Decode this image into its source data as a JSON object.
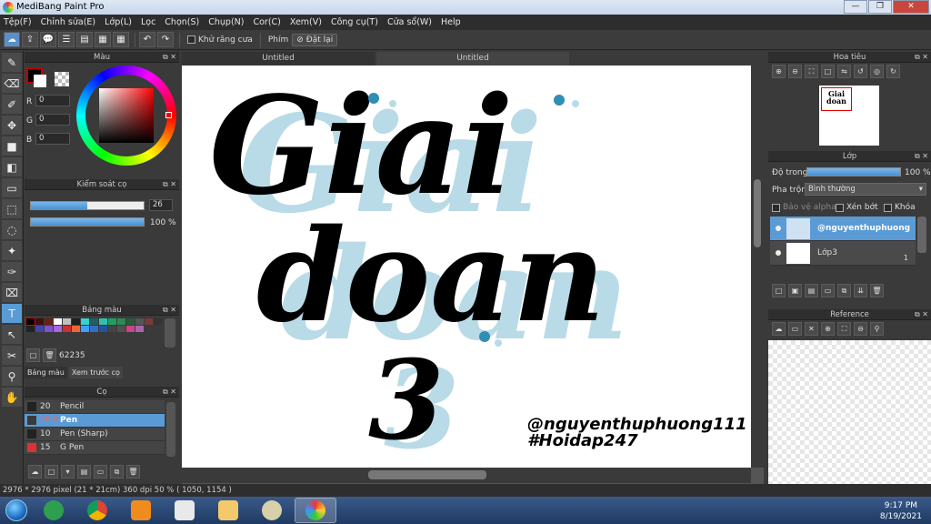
{
  "window": {
    "title": "MediBang Paint Pro",
    "minimize": "—",
    "restore": "❐",
    "close": "✕"
  },
  "menu": [
    "Tệp(F)",
    "Chỉnh sửa(E)",
    "Lớp(L)",
    "Lọc",
    "Chọn(S)",
    "Chụp(N)",
    "Cor(C)",
    "Xem(V)",
    "Công cụ(T)",
    "Cửa sổ(W)",
    "Help"
  ],
  "toolbar": {
    "antialias_label": "Khử răng cưa",
    "shortcut_label": "Phím",
    "reset_label": "Đặt lại"
  },
  "tabs": [
    {
      "label": "Untitled"
    },
    {
      "label": "Untitled"
    }
  ],
  "color_panel": {
    "title": "Màu",
    "r_label": "R",
    "g_label": "G",
    "b_label": "B",
    "r_value": "0",
    "g_value": "0",
    "b_value": "0",
    "fg_color": "#000000",
    "accent": "#c00000"
  },
  "brush_control": {
    "title": "Kiểm soát cọ",
    "size_value": "26",
    "size_fraction": 0.5,
    "opacity_value": "100 %",
    "opacity_fraction": 1.0
  },
  "palette": {
    "title": "Bảng màu",
    "count": "62235",
    "tab_palette": "Bảng màu",
    "tab_preview": "Xem trước cọ",
    "colors": [
      "#000000",
      "#3a1010",
      "#6a2010",
      "#ffffff",
      "#c0c0c0",
      "#202020",
      "#3ad0d0",
      "#206060",
      "#30c0b0",
      "#20a060",
      "#2d8a55",
      "#285c3a",
      "#555555",
      "#7a3a3a",
      "#333333",
      "#222222",
      "#4444aa",
      "#7a55cc",
      "#aa66dd",
      "#cc3030",
      "#ee6633",
      "#40a0ff",
      "#3070cc",
      "#225599",
      "#444444",
      "#505050",
      "#cc4488",
      "#aa66aa"
    ]
  },
  "brushes": {
    "title": "Cọ",
    "items": [
      {
        "size": "20",
        "name": "Pencil",
        "color": "#222222"
      },
      {
        "size": "26.0",
        "name": "Pen",
        "color": "#3a3a3a"
      },
      {
        "size": "10",
        "name": "Pen (Sharp)",
        "color": "#222222"
      },
      {
        "size": "15",
        "name": "G Pen",
        "color": "#e03030"
      }
    ]
  },
  "navigator": {
    "title": "Hoa tiêu"
  },
  "layer_panel": {
    "title": "Lớp",
    "opacity_label": "Độ trong",
    "opacity_value": "100 %",
    "opacity_fraction": 1.0,
    "blend_label": "Pha trộn",
    "blend_value": "Bình thường",
    "protect_alpha": "Bảo vệ alpha",
    "clipping": "Xén bớt",
    "lock": "Khóa",
    "layers": [
      {
        "name": "@nguyenthuphuong",
        "sel": true
      },
      {
        "name": "Lớp3",
        "blend_mark": "1",
        "sel": false
      }
    ]
  },
  "reference": {
    "title": "Reference"
  },
  "canvas_art": {
    "line1": "Giai",
    "line2": "doan",
    "line3": "3",
    "signature1": "@nguyenthuphuong111",
    "signature2": "#Hoidap247",
    "ink_color": "#000000",
    "shadow_color": "#b8dbe7",
    "dot_color": "#2e8fb3"
  },
  "status": "2976 * 2976 pixel  (21 * 21cm)  360 dpi  50 %  ( 1050, 1154 )",
  "taskbar": {
    "time": "9:17 PM",
    "date": "8/19/2021"
  }
}
